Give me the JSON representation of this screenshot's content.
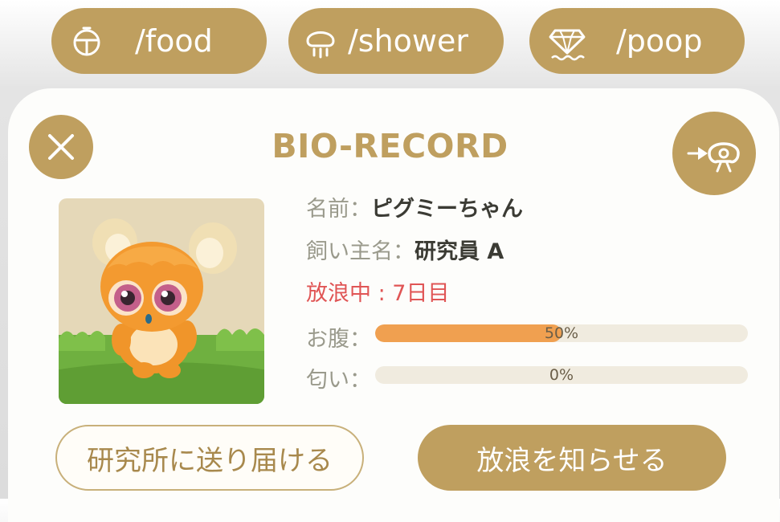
{
  "commands": [
    {
      "label": "/food",
      "icon": "food-bowl-icon"
    },
    {
      "label": "/shower",
      "icon": "shower-icon"
    },
    {
      "label": "/poop",
      "icon": "poop-gem-icon"
    }
  ],
  "card": {
    "title": "BIO-RECORD",
    "close_icon": "close-icon",
    "transfer_icon": "send-to-character-icon",
    "portrait": "creature-portrait",
    "info": {
      "name_label": "名前：",
      "name_value": "ピグミーちゃん",
      "owner_label": "飼い主名：",
      "owner_value": "研究員 A",
      "release_status": "放浪中 : 7日目",
      "hunger_label": "お腹：",
      "hunger_value": "50%",
      "hunger_level": 0.5,
      "smell_label": "匂い：",
      "smell_value": "0%",
      "smell_level": 0.0
    },
    "buttons": {
      "deliver": "研究所に送り届ける",
      "notify": "放浪を知らせる"
    }
  },
  "colors": {
    "gold": "#bf9f5f",
    "orange_bar": "#f0a050",
    "status_red": "#e05555"
  }
}
